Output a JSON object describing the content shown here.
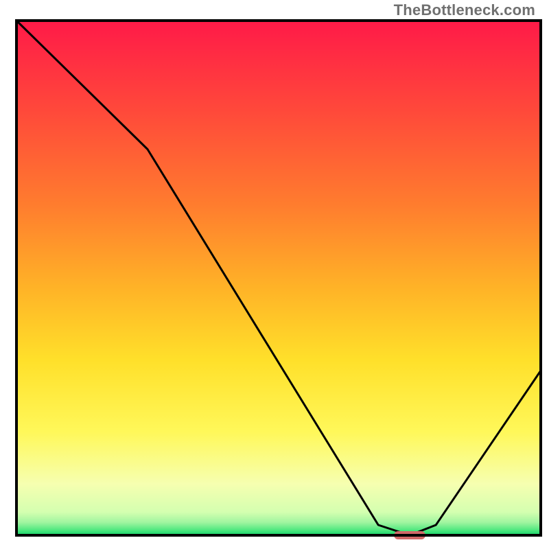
{
  "watermark": "TheBottleneck.com",
  "chart_data": {
    "type": "line",
    "title": "",
    "xlabel": "",
    "ylabel": "",
    "xlim": [
      0,
      100
    ],
    "ylim": [
      0,
      100
    ],
    "x": [
      0,
      25,
      69,
      75,
      80,
      100
    ],
    "values": [
      100,
      75,
      2,
      0,
      2,
      32
    ],
    "marker": {
      "x_start": 72,
      "x_end": 78,
      "y": 0
    },
    "gradient_stops": [
      {
        "offset": 0.0,
        "color": "#ff1a48"
      },
      {
        "offset": 0.18,
        "color": "#ff4a3a"
      },
      {
        "offset": 0.36,
        "color": "#ff7d2e"
      },
      {
        "offset": 0.52,
        "color": "#ffb327"
      },
      {
        "offset": 0.66,
        "color": "#ffe02a"
      },
      {
        "offset": 0.8,
        "color": "#fff85a"
      },
      {
        "offset": 0.9,
        "color": "#f6ffb0"
      },
      {
        "offset": 0.955,
        "color": "#d4ffb0"
      },
      {
        "offset": 0.975,
        "color": "#a0f5a0"
      },
      {
        "offset": 0.99,
        "color": "#4fe87f"
      },
      {
        "offset": 1.0,
        "color": "#13d36a"
      }
    ],
    "frame_color": "#000000",
    "line_color": "#000000",
    "marker_color": "#d06868"
  }
}
